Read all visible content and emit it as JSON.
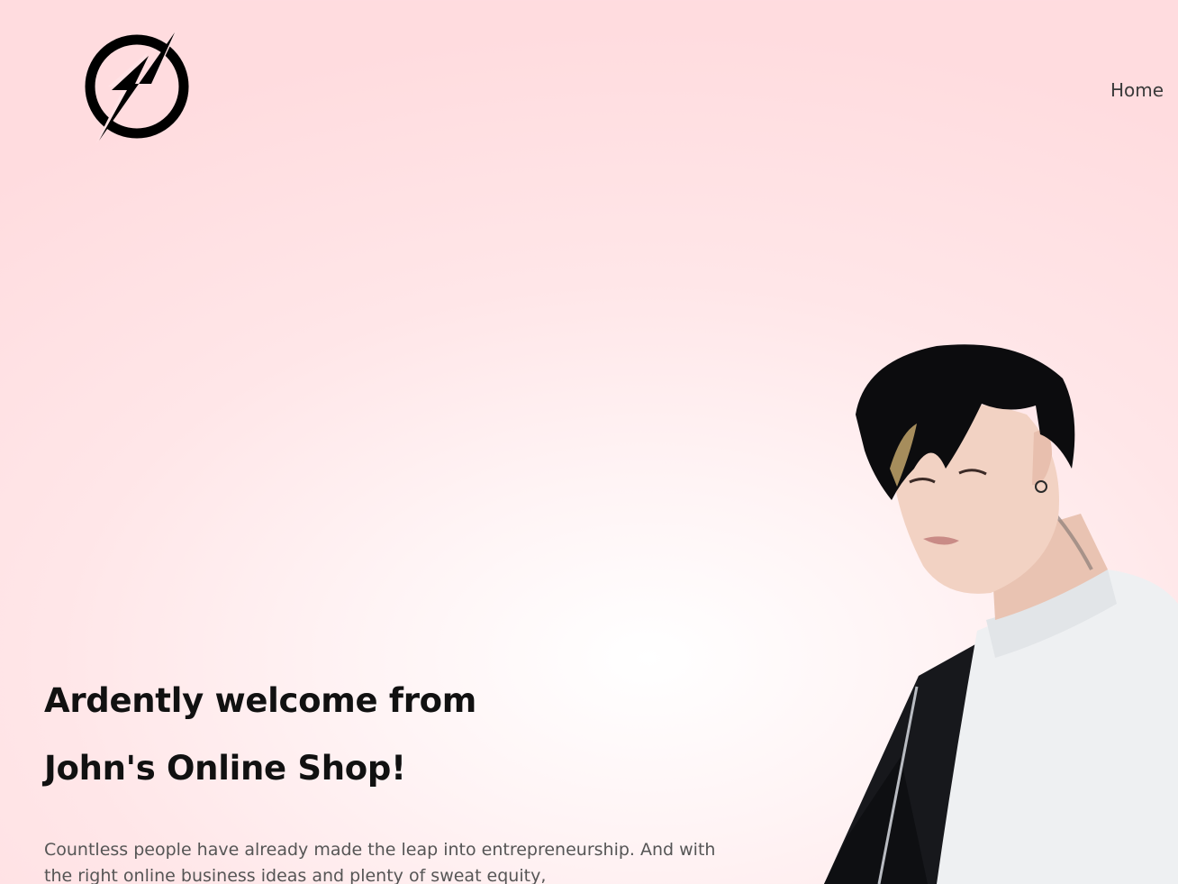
{
  "header": {
    "logo_icon": "lightning-bolt-circle-icon",
    "nav": [
      {
        "label": "Home"
      }
    ]
  },
  "hero": {
    "title_line1": "Ardently welcome from",
    "title_line2": "John's Online Shop!",
    "description": "Countless people have already made the leap into entrepreneurship. And with the right online business ideas and plenty of sweat equity,",
    "image": "model-portrait"
  },
  "colors": {
    "background_edge": "#ffdcdf",
    "background_center": "#ffffff",
    "heading": "#111111",
    "body_text": "#555555",
    "nav_text": "#3a3a3a"
  }
}
